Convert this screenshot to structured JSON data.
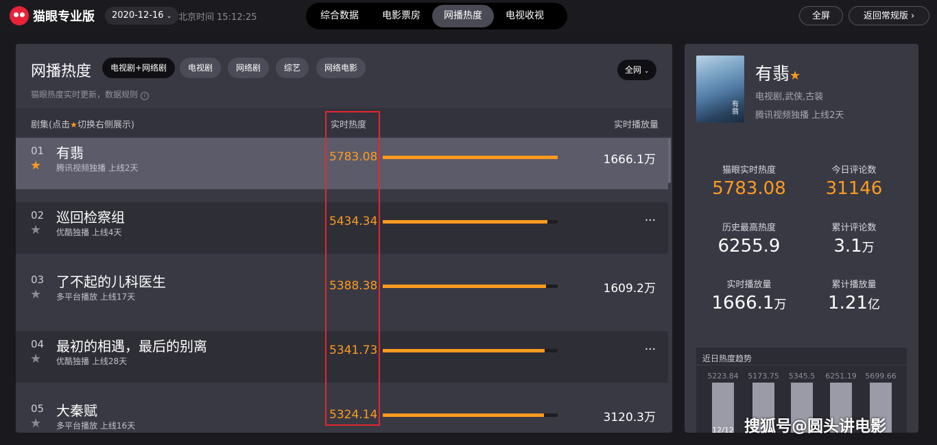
{
  "topbar": {
    "app_name": "猫眼专业版",
    "date": "2020-12-16",
    "clock": "北京时间 15:12:25",
    "tabs": [
      {
        "label": "综合数据"
      },
      {
        "label": "电影票房"
      },
      {
        "label": "网播热度",
        "active": true
      },
      {
        "label": "电视收视"
      }
    ],
    "fullscreen": "全屏",
    "back": "返回常规版"
  },
  "panel": {
    "title": "网播热度",
    "filters": [
      "电视剧+网络剧",
      "电视剧",
      "网络剧",
      "综艺",
      "网络电影"
    ],
    "scope": "全网",
    "note": "猫眼热度实时更新，数据规则",
    "col_series_a": "剧集(点击",
    "col_series_b": "切换右侧展示)",
    "col_heat": "实时热度",
    "col_play": "实时播放量"
  },
  "rows": [
    {
      "rank": "01",
      "name": "有翡",
      "meta": "腾讯视频独播  上线2天",
      "heat": "5783.08",
      "heat_value": 5783.08,
      "play": "1666.1万",
      "starred": true
    },
    {
      "rank": "02",
      "name": "巡回检察组",
      "meta": "优酷独播  上线4天",
      "heat": "5434.34",
      "heat_value": 5434.34,
      "play": "···",
      "starred": false
    },
    {
      "rank": "03",
      "name": "了不起的儿科医生",
      "meta": "多平台播放  上线17天",
      "heat": "5388.38",
      "heat_value": 5388.38,
      "play": "1609.2万",
      "starred": false
    },
    {
      "rank": "04",
      "name": "最初的相遇，最后的别离",
      "meta": "优酷独播  上线28天",
      "heat": "5341.73",
      "heat_value": 5341.73,
      "play": "···",
      "starred": false
    },
    {
      "rank": "05",
      "name": "大秦赋",
      "meta": "多平台播放  上线16天",
      "heat": "5324.14",
      "heat_value": 5324.14,
      "play": "3120.3万",
      "starred": false
    }
  ],
  "heat_bar_scale": 5783.08,
  "detail": {
    "poster_text": "有翡",
    "name": "有翡",
    "genre": "电视剧,武侠,古装",
    "platform": "腾讯视频独播  上线2天",
    "stats": [
      {
        "label": "猫眼实时热度",
        "value": "5783.08",
        "unit": "",
        "orange": true
      },
      {
        "label": "今日评论数",
        "value": "31146",
        "unit": "",
        "orange": true
      },
      {
        "label": "历史最高热度",
        "value": "6255.9",
        "unit": ""
      },
      {
        "label": "累计评论数",
        "value": "3.1",
        "unit": "万"
      },
      {
        "label": "实时播放量",
        "value": "1666.1",
        "unit": "万"
      },
      {
        "label": "累计播放量",
        "value": "1.21",
        "unit": "亿"
      }
    ],
    "trend": {
      "title": "近日热度趋势",
      "values": [
        "5223.84",
        "5173.75",
        "5345.5",
        "6251.19",
        "5699.66"
      ],
      "first_date": "12/12"
    }
  },
  "watermark": "搜狐号@圆头讲电影",
  "colors": {
    "accent": "#ff9b1f",
    "highlight_box": "#e6262e"
  }
}
